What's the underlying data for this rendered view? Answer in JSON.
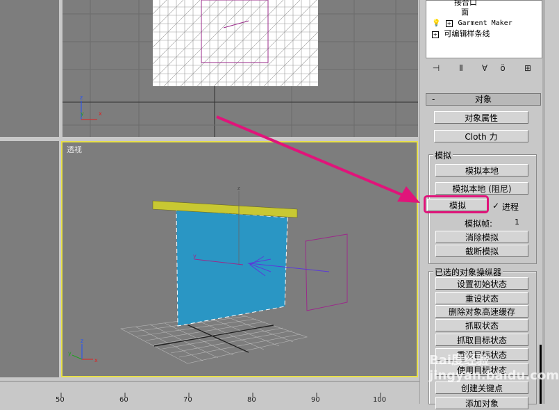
{
  "viewports": {
    "perspective_label": "透视"
  },
  "axes": {
    "x": "x",
    "y": "y",
    "z": "z"
  },
  "tree": {
    "items": [
      {
        "label": "接合口"
      },
      {
        "label": "面"
      },
      {
        "label": "Garment Maker"
      },
      {
        "label": "可编辑样条线"
      }
    ]
  },
  "rollout": {
    "collapse_symbol": "-",
    "title": "对象"
  },
  "buttons": {
    "object_properties": "对象属性",
    "cloth_forces": "Cloth 力"
  },
  "simulation": {
    "group_title": "模拟",
    "local": "模拟本地",
    "local_damped": "模拟本地 (阻尼)",
    "simulate": "模拟",
    "progress_label": "进程",
    "progress_checked": true,
    "frames_label": "模拟帧:",
    "frames_value": "1",
    "erase": "消除模拟",
    "truncate": "截断模拟"
  },
  "selected_manip": {
    "group_title": "已选的对象操纵器",
    "set_initial": "设置初始状态",
    "reset": "重设状态",
    "delete_cache": "删除对象高速缓存",
    "grab_state": "抓取状态",
    "grab_target": "抓取目标状态",
    "reset_target": "重设目标状态",
    "use_target": "使用目标状态",
    "create_keys": "创建关键点",
    "add_obj": "添加对象"
  },
  "ruler": {
    "ticks": [
      "50",
      "60",
      "70",
      "80",
      "90",
      "100"
    ]
  },
  "watermark": "Bai度经验 jingyan.baidu.com",
  "colors": {
    "highlight": "#e0147a",
    "active_viewport_border": "#e8e04a",
    "cloth": "#2a96c4",
    "rod": "#c8c832",
    "wind_gizmo": "#9a2a8a"
  }
}
